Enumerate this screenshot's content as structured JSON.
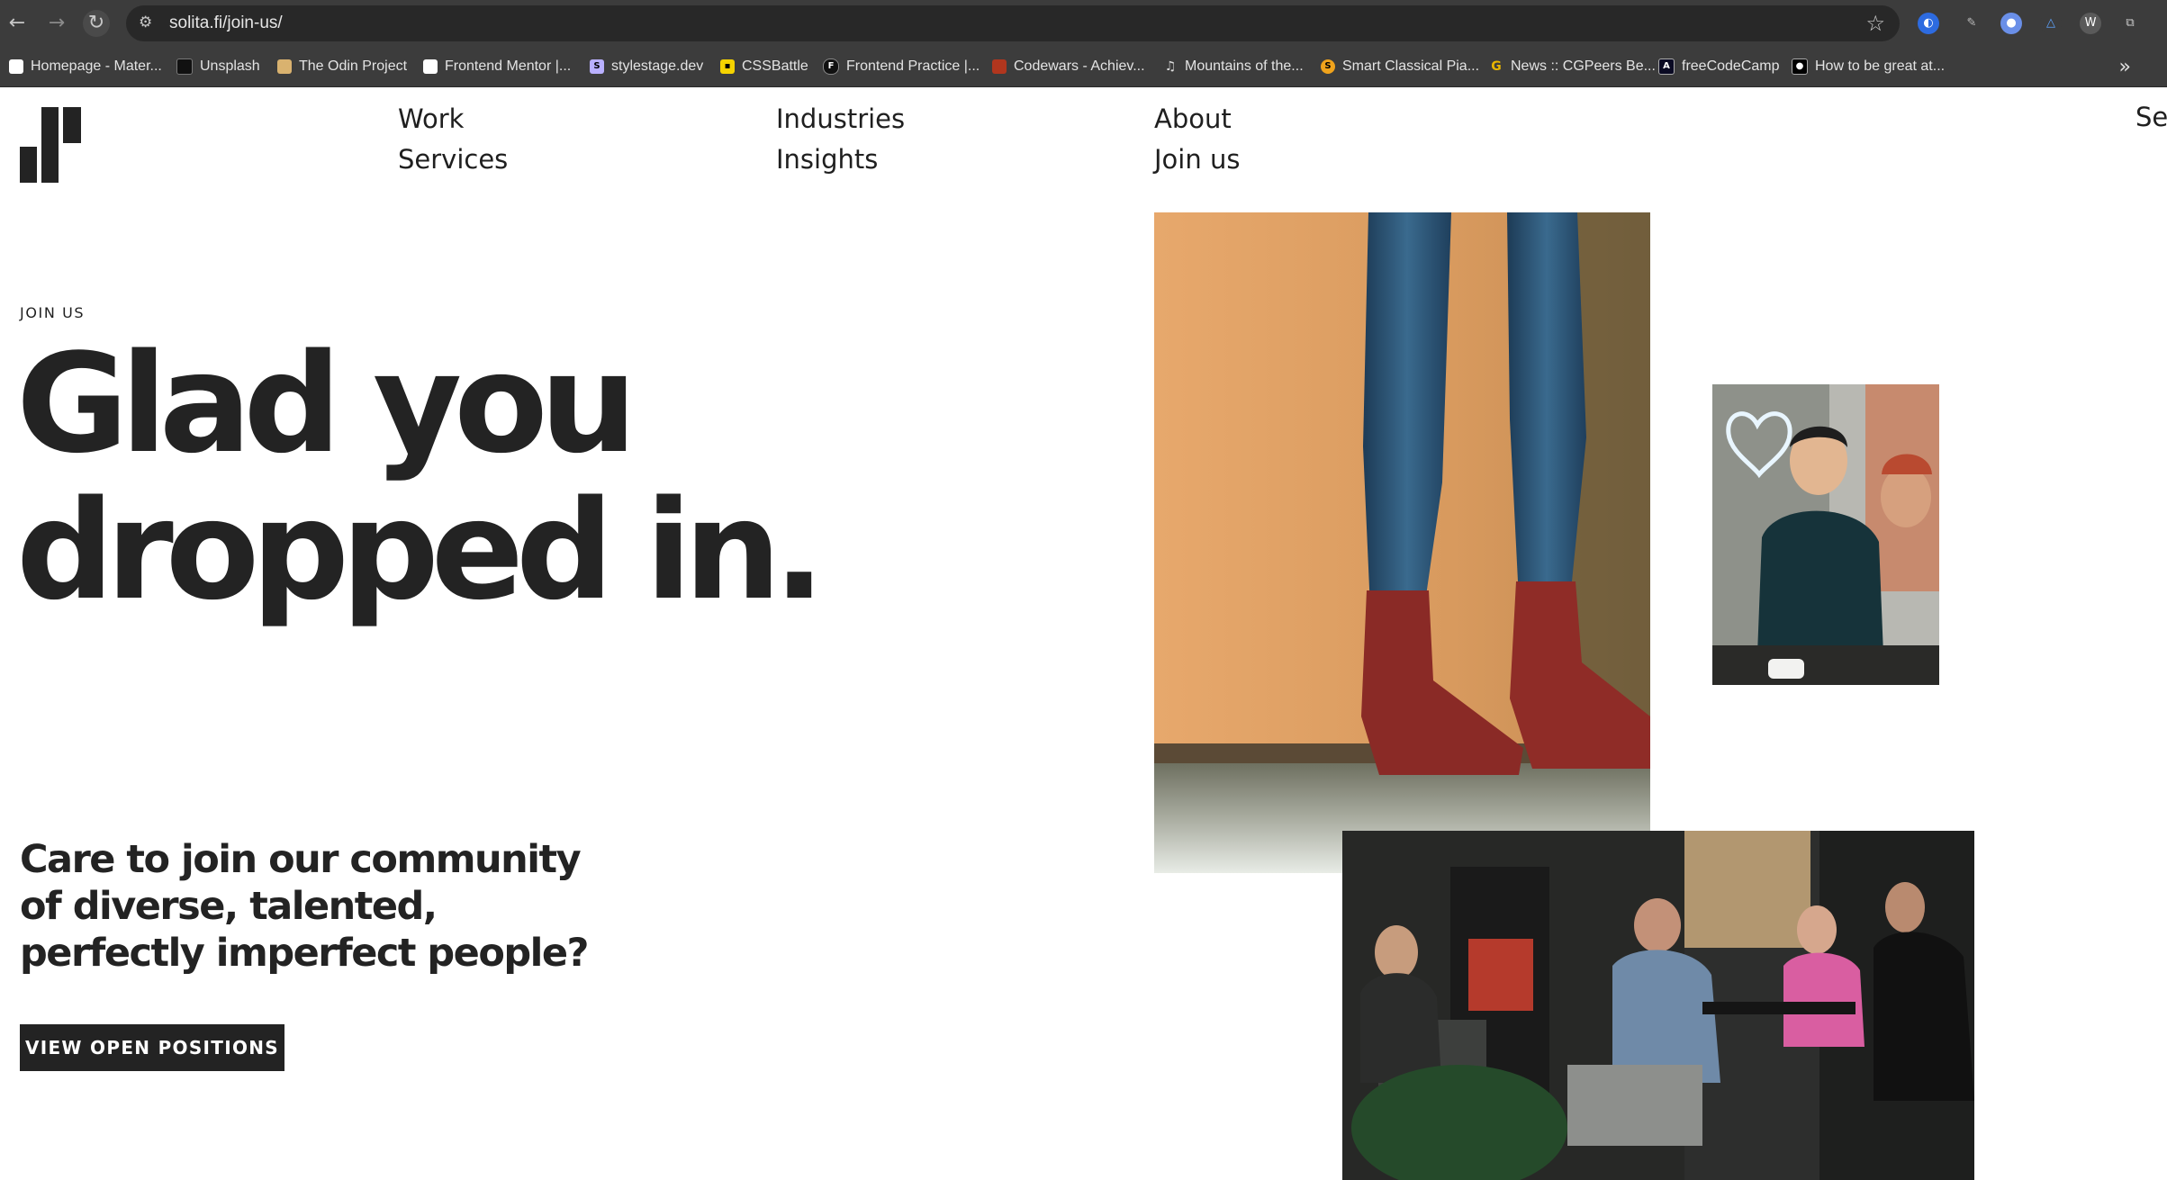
{
  "browser": {
    "url": "solita.fi/join-us/",
    "bookmarks": [
      {
        "label": "Homepage - Mater...",
        "icon": "materialize-favicon-icon",
        "color": "#ffffff"
      },
      {
        "label": "Unsplash",
        "icon": "unsplash-favicon-icon",
        "color": "#111111"
      },
      {
        "label": "The Odin Project",
        "icon": "odin-project-favicon-icon",
        "color": "#d9b26f"
      },
      {
        "label": "Frontend Mentor |...",
        "icon": "frontend-mentor-favicon-icon",
        "color": "#ffffff"
      },
      {
        "label": "stylestage.dev",
        "icon": "stylestage-favicon-icon",
        "color": "#b9b0ff"
      },
      {
        "label": "CSSBattle",
        "icon": "cssbattle-favicon-icon",
        "color": "#f5d300"
      },
      {
        "label": "Frontend Practice |...",
        "icon": "frontend-practice-favicon-icon",
        "color": "#111111"
      },
      {
        "label": "Codewars - Achiev...",
        "icon": "codewars-favicon-icon",
        "color": "#b1361e"
      },
      {
        "label": "Mountains of the...",
        "icon": "music-note-favicon-icon",
        "color": "#3c3c3c"
      },
      {
        "label": "Smart Classical Pia...",
        "icon": "smart-classical-favicon-icon",
        "color": "#f0a31c"
      },
      {
        "label": "News :: CGPeers Be...",
        "icon": "cgpeers-favicon-icon",
        "color": "#e8b500"
      },
      {
        "label": "freeCodeCamp",
        "icon": "freecodecamp-favicon-icon",
        "color": "#0a0a23"
      },
      {
        "label": "How to be great at...",
        "icon": "medium-favicon-icon",
        "color": "#000000"
      }
    ]
  },
  "nav": {
    "work": "Work",
    "services": "Services",
    "industries": "Industries",
    "insights": "Insights",
    "about": "About",
    "join_us": "Join us",
    "search_partial": "Se"
  },
  "hero": {
    "eyebrow": "JOIN US",
    "title_line1": "Glad you",
    "title_line2": "dropped in.",
    "subtitle": "Care to join our community of diverse, talented, perfectly imperfect people?",
    "cta": "VIEW OPEN POSITIONS"
  },
  "colors": {
    "text": "#232323",
    "button_bg": "#232323",
    "button_text": "#ffffff",
    "chrome_bg": "#3c3c3c"
  }
}
